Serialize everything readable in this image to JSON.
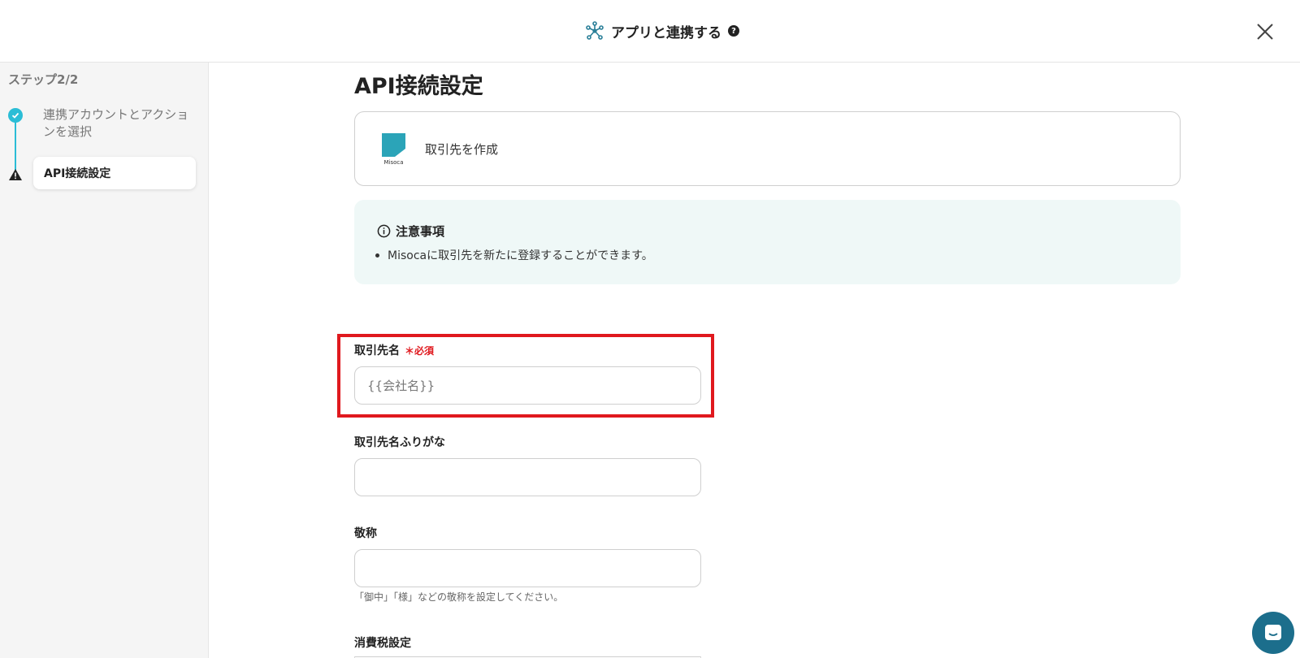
{
  "header": {
    "title": "アプリと連携する",
    "help_glyph": "?",
    "app_icon": "network-icon",
    "close_icon": "close-icon"
  },
  "sidebar": {
    "step_label": "ステップ2/2",
    "steps": [
      {
        "label": "連携アカウントとアクションを選択",
        "status": "completed",
        "icon": "check-icon"
      },
      {
        "label": "API接続設定",
        "status": "current-warning",
        "icon": "warning-icon"
      }
    ]
  },
  "main": {
    "title": "API接続設定",
    "action_card": {
      "app_name": "Misoca",
      "action": "取引先を作成"
    },
    "notice": {
      "title": "注意事項",
      "items": [
        "Misocaに取引先を新たに登録することができます。"
      ]
    },
    "fields": [
      {
        "label": "取引先名",
        "required_mark": "＊",
        "required_text": "必須",
        "value": "{{会社名}}",
        "highlighted": true
      },
      {
        "label": "取引先名ふりがな",
        "value": ""
      },
      {
        "label": "敬称",
        "value": "",
        "hint": "「御中」「様」などの敬称を設定してください。"
      },
      {
        "label": "消費税設定"
      }
    ]
  },
  "colors": {
    "accent": "#2bbdd6",
    "required": "#e0191e",
    "notice_bg": "#eff8f7",
    "chat": "#1c6e8c",
    "misoca_logo": "#2ba4b8"
  }
}
